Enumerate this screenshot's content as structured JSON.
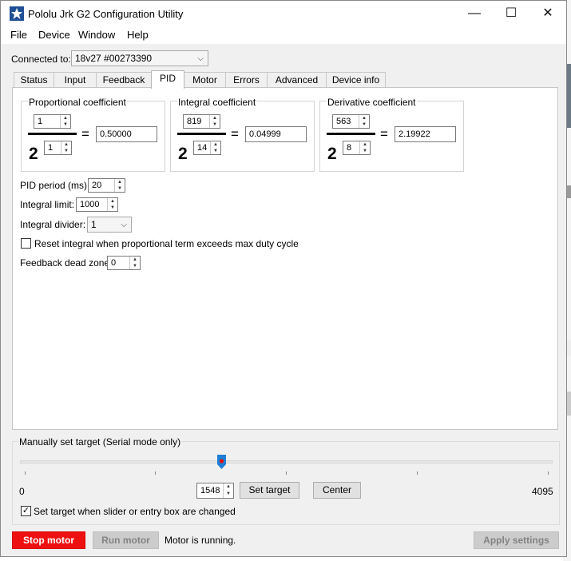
{
  "window": {
    "title": "Pololu Jrk G2 Configuration Utility",
    "minimize_glyph": "—",
    "maximize_glyph": "☐",
    "close_glyph": "✕"
  },
  "menu": [
    "File",
    "Device",
    "Window",
    "Help"
  ],
  "connection": {
    "label": "Connected to:",
    "device": "18v27 #00273390"
  },
  "tabs": [
    "Status",
    "Input",
    "Feedback",
    "PID",
    "Motor",
    "Errors",
    "Advanced",
    "Device info"
  ],
  "active_tab": "PID",
  "coefficients": [
    {
      "title": "Proportional coefficient",
      "multiplier": "1",
      "base": "2",
      "exponent": "1",
      "result": "0.50000"
    },
    {
      "title": "Integral coefficient",
      "multiplier": "819",
      "base": "2",
      "exponent": "14",
      "result": "0.04999"
    },
    {
      "title": "Derivative coefficient",
      "multiplier": "563",
      "base": "2",
      "exponent": "8",
      "result": "2.19922"
    }
  ],
  "equals_sign": "=",
  "pid_settings": {
    "pid_period_label": "PID period (ms):",
    "pid_period": "20",
    "integral_limit_label": "Integral limit:",
    "integral_limit": "1000",
    "integral_divider_label": "Integral divider:",
    "integral_divider": "1",
    "reset_integral_label": "Reset integral when proportional term exceeds max duty cycle",
    "reset_integral_checked": false,
    "dead_zone_label": "Feedback dead zone:",
    "dead_zone": "0"
  },
  "manual_target": {
    "title": "Manually set target (Serial mode only)",
    "min": "0",
    "max": "4095",
    "value": "1548",
    "slider_fraction": 0.378,
    "set_target_label": "Set target",
    "center_label": "Center",
    "auto_set_label": "Set target when slider or entry box are changed",
    "auto_set_checked": true,
    "check_glyph": "✓"
  },
  "footer": {
    "stop_label": "Stop motor",
    "run_label": "Run motor",
    "status": "Motor is running.",
    "apply_label": "Apply settings"
  },
  "colors": {
    "stop": "#ee1111",
    "accent": "#1f4f94",
    "thumb": "#1e7fd6",
    "thumb_dot": "#d11"
  }
}
